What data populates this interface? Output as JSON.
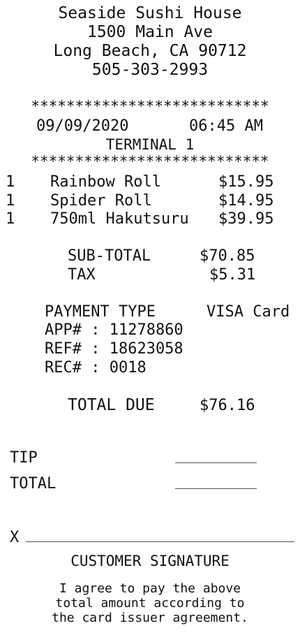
{
  "merchant": {
    "name": "Seaside Sushi House",
    "address": "1500 Main Ave",
    "city_line": "Long Beach, CA 90712",
    "phone": "505-303-2993"
  },
  "separator": "***************************",
  "transaction": {
    "date": "09/09/2020",
    "time": "06:45 AM",
    "terminal": "TERMINAL 1"
  },
  "items": [
    {
      "qty": "1",
      "name": "Rainbow Roll",
      "price": "$15.95"
    },
    {
      "qty": "1",
      "name": "Spider Roll",
      "price": "$14.95"
    },
    {
      "qty": "1",
      "name": "750ml Hakutsuru",
      "price": "$39.95"
    }
  ],
  "totals": {
    "subtotal_label": "SUB-TOTAL",
    "subtotal_value": "$70.85",
    "tax_label": "TAX",
    "tax_value": "$5.31"
  },
  "payment": {
    "type_label": "PAYMENT TYPE",
    "type_value": "VISA Card",
    "app_line": "APP# : 11278860",
    "ref_line": "REF# : 18623058",
    "rec_line": "REC# : 0018"
  },
  "total_due": {
    "label": "TOTAL DUE",
    "value": "$76.16"
  },
  "tip_section": {
    "tip_label": "TIP",
    "total_label": "TOTAL"
  },
  "signature": {
    "x_mark": "X",
    "label": "CUSTOMER SIGNATURE"
  },
  "agreement": [
    "I agree to pay the above",
    "total amount according to",
    "the card issuer agreement."
  ]
}
